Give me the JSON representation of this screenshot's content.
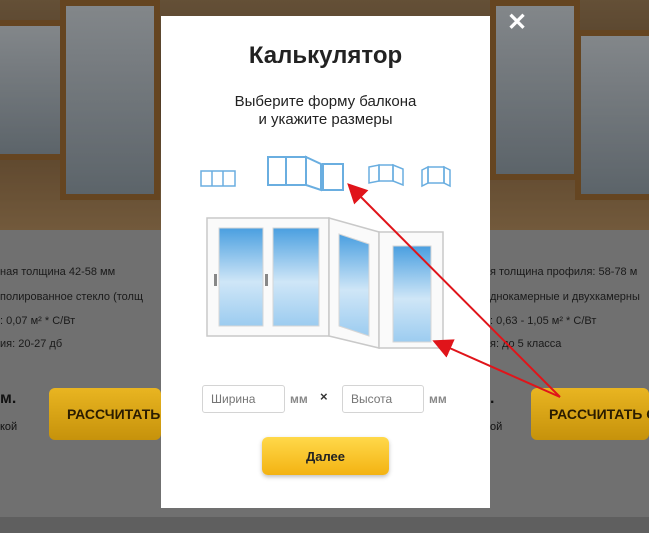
{
  "background": {
    "specs_left": [
      "ная толщина 42-58 мм",
      " полированное стекло (толщ",
      ": 0,07 м² * С/Вт",
      "ия: 20-27 дб"
    ],
    "specs_right": [
      "я толщина профиля: 58-78 м",
      "днокамерные и двухкамерны",
      ": 0,63 - 1,05 м² * С/Вт",
      "я: до 5 класса"
    ],
    "price_left": "м.",
    "price_right": ".",
    "note_left": "кой",
    "note_right": "ой",
    "btn_left": "РАССЧИТАТЬ",
    "btn_right": "РАССЧИТАТЬ С"
  },
  "modal": {
    "close": "✕",
    "title": "Калькулятор",
    "subtitle_line1": "Выберите форму балкона",
    "subtitle_line2": "и укажите размеры",
    "shapes": [
      "straight-balcony",
      "l-shape-balcony",
      "bay-balcony",
      "u-shape-balcony"
    ],
    "width_placeholder": "Ширина",
    "height_placeholder": "Высота",
    "unit": "мм",
    "times": "×",
    "next_label": "Далее"
  },
  "colors": {
    "accent_yellow": "#f7c52a",
    "shape_blue": "#6aaee0",
    "arrow_red": "#e0141a"
  }
}
